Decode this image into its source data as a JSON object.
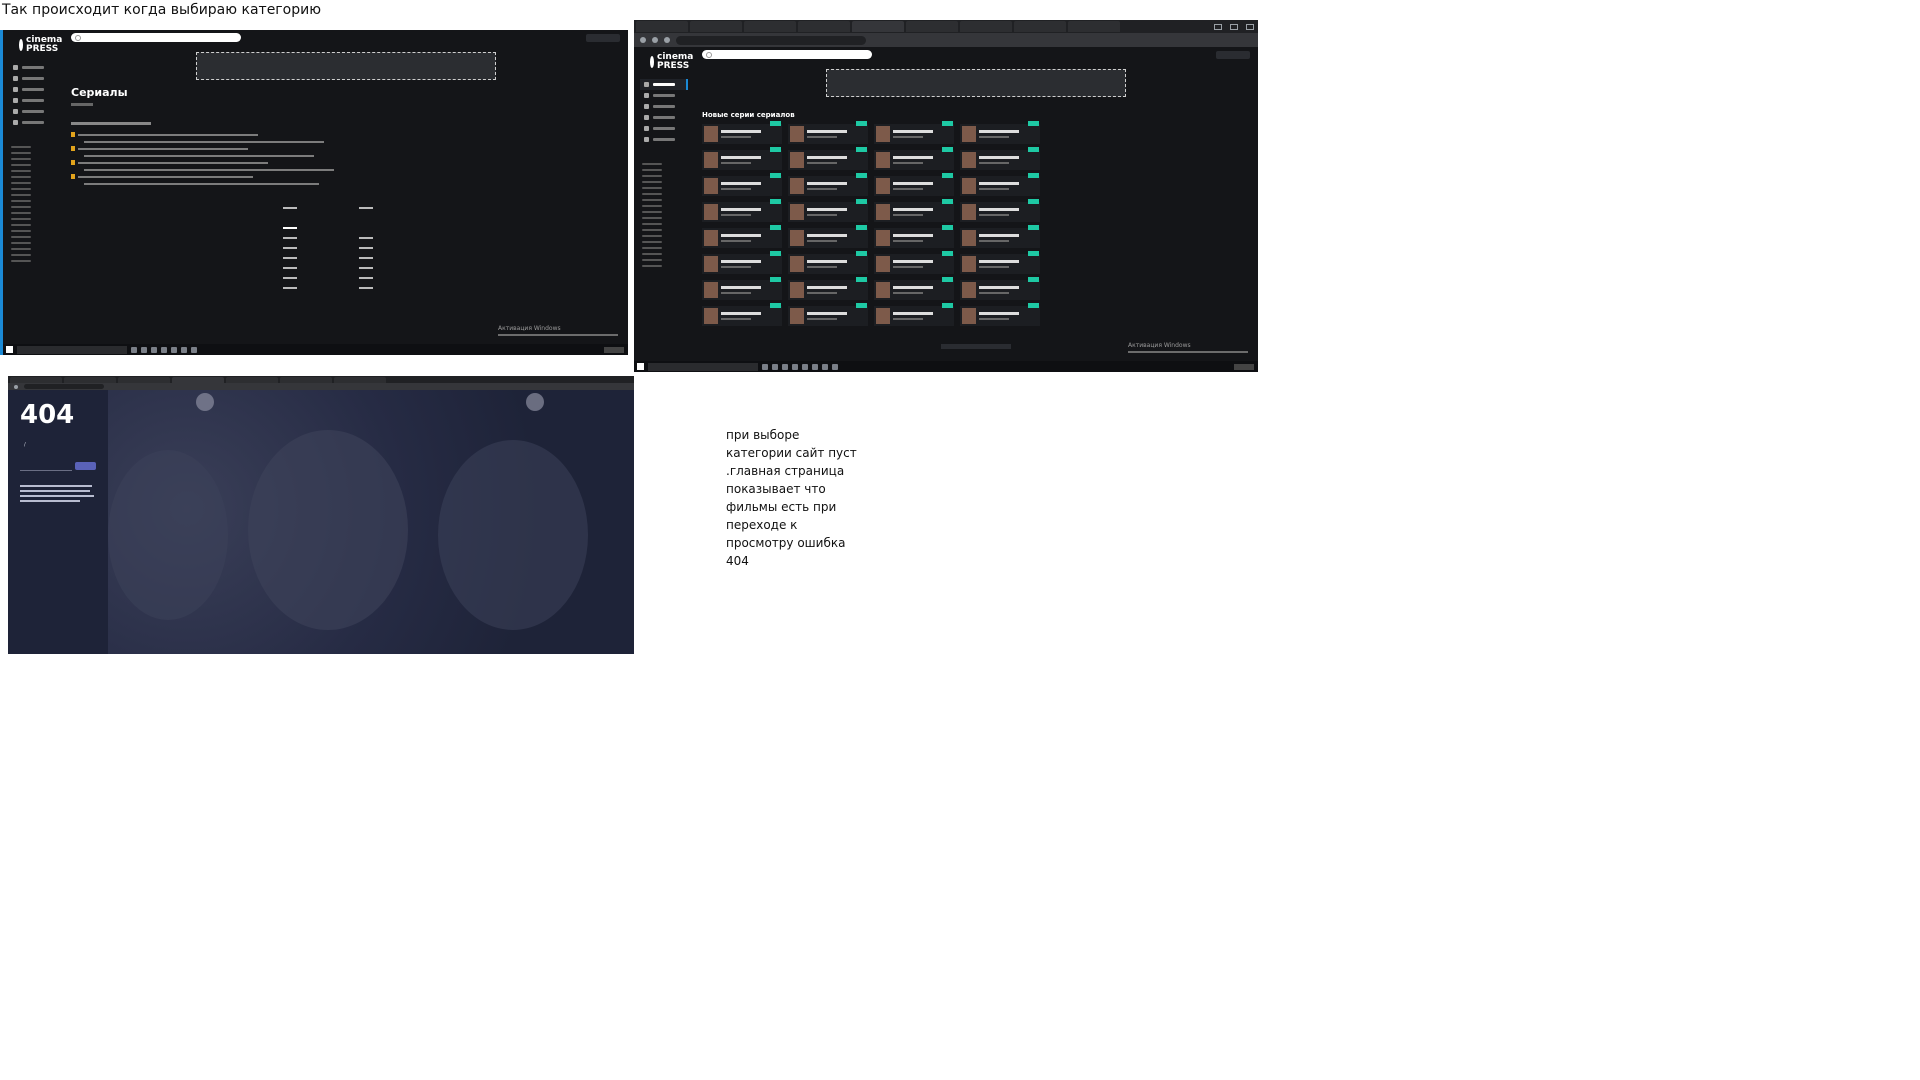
{
  "caption": "Так происходит когда выбираю категорию",
  "note": "при выборе\nкатегории сайт пуст\n.главная страница\nпоказывает что\nфильмы есть при\nпереходе к\nпросмотру ошибка\n404",
  "shot1": {
    "logo": "cinema PRESS",
    "menu_header": "",
    "page_heading": "Сериалы",
    "activation_title": "Активация Windows"
  },
  "shot2": {
    "url_title": "",
    "logo": "cinema PRESS",
    "section_title": "Новые серии сериалов",
    "activation_title": "Активация Windows"
  },
  "shot3": {
    "error_code": "404",
    "error_label": "",
    "crumb_home": "",
    "crumb_sep": "/",
    "crumb_current": ""
  },
  "colors": {
    "accent": "#1b8ad6",
    "badge": "#1ec9a4",
    "site_bg": "#141518",
    "error_bg": "#1e2338"
  }
}
